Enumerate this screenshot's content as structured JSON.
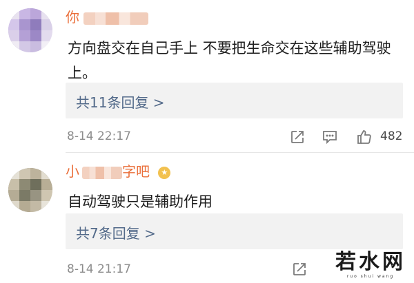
{
  "colors": {
    "username": "#ea6f3a",
    "reply_link": "#536a8a",
    "reply_bg": "#f2f2f2",
    "meta": "#8d8d8d"
  },
  "comments": [
    {
      "username_visible": "你",
      "avatar_icon": "avatar-mosaic",
      "text": "方向盘交在自己手上  不要把生命交在这些辅助驾驶上。",
      "replies_label": "共11条回复 >",
      "time": "8-14 22:17",
      "like_count": "482",
      "icons": [
        "share-icon",
        "comment-icon",
        "like-icon"
      ]
    },
    {
      "username_visible_prefix": "小",
      "username_visible_suffix": "字吧",
      "badge_icon": "vip-badge-icon",
      "avatar_icon": "avatar-mosaic",
      "text": "自动驾驶只是辅助作用",
      "replies_label": "共7条回复 >",
      "time": "8-14 21:17",
      "icons": [
        "share-icon"
      ]
    }
  ],
  "watermark": {
    "text": "若水网",
    "sub": "ruo shui wang"
  }
}
